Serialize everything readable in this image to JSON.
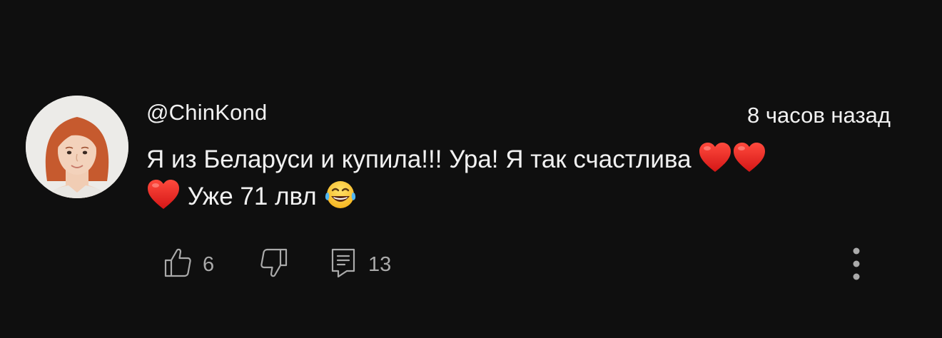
{
  "comment": {
    "author": "@ChinKond",
    "timestamp": "8 часов назад",
    "text_line1": "Я из Беларуси и купила!!! Ура! Я так счастлива",
    "text_line2": "Уже 71 лвл",
    "emojis": [
      "red-heart",
      "red-heart",
      "red-heart",
      "face-with-tears-of-joy"
    ],
    "likes": "6",
    "replies": "13"
  },
  "icons": {
    "like": "thumbs-up-icon",
    "dislike": "thumbs-down-icon",
    "reply": "comment-icon",
    "more": "more-vertical-icon"
  },
  "colors": {
    "background": "#0f0f0f",
    "text": "#f1f1f1",
    "secondary_text": "#aaaaaa",
    "heart": "#e8201c"
  }
}
